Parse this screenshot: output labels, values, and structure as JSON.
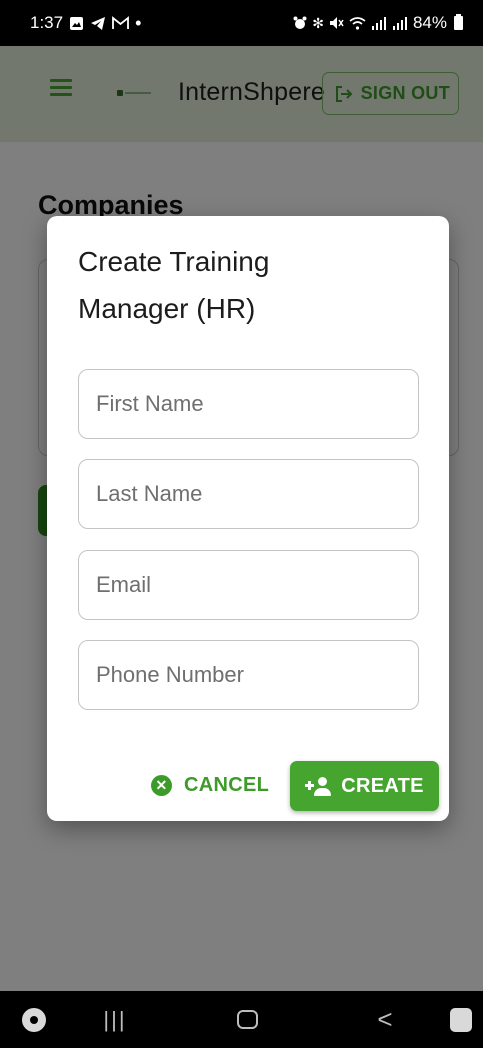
{
  "status_bar": {
    "time": "1:37",
    "left_icons": [
      "image-icon",
      "telegram-icon",
      "gmail-icon",
      "dot-icon"
    ],
    "right_icons": [
      "alarm-icon",
      "bluetooth-icon",
      "mute-icon",
      "wifi-icon",
      "signal-icon",
      "signal-icon"
    ],
    "battery": "84%"
  },
  "app_bar": {
    "title": "InternShpere",
    "sign_out_label": "SIGN OUT",
    "accent_color": "#4aa336",
    "background_color": "#e4f1dc"
  },
  "page": {
    "title": "Companies"
  },
  "dialog": {
    "title": "Create Training Manager (HR)",
    "fields": {
      "first_name": {
        "placeholder": "First Name",
        "value": ""
      },
      "last_name": {
        "placeholder": "Last Name",
        "value": ""
      },
      "email": {
        "placeholder": "Email",
        "value": ""
      },
      "phone": {
        "placeholder": "Phone Number",
        "value": ""
      }
    },
    "cancel_label": "CANCEL",
    "create_label": "CREATE",
    "primary_color": "#45a52e"
  },
  "nav_bar": {
    "items": [
      "apps-icon",
      "recents-icon",
      "home-icon",
      "back-icon",
      "assistant-icon"
    ],
    "recents_glyph": "|||",
    "back_glyph": "<"
  }
}
